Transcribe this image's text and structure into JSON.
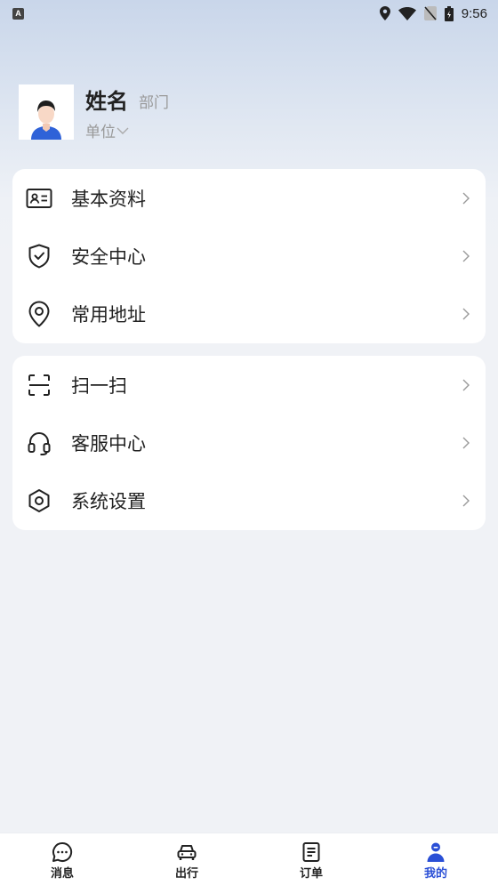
{
  "status_bar": {
    "app_badge": "A",
    "time": "9:56"
  },
  "profile": {
    "name": "姓名",
    "department": "部门",
    "unit": "单位"
  },
  "menu_group_1": [
    {
      "label": "基本资料",
      "icon": "id-card-icon"
    },
    {
      "label": "安全中心",
      "icon": "shield-check-icon"
    },
    {
      "label": "常用地址",
      "icon": "location-pin-icon"
    }
  ],
  "menu_group_2": [
    {
      "label": "扫一扫",
      "icon": "scan-icon"
    },
    {
      "label": "客服中心",
      "icon": "headset-icon"
    },
    {
      "label": "系统设置",
      "icon": "hexagon-settings-icon"
    }
  ],
  "tabbar": [
    {
      "label": "消息",
      "icon": "message-bubble-icon",
      "active": false
    },
    {
      "label": "出行",
      "icon": "car-icon",
      "active": false
    },
    {
      "label": "订单",
      "icon": "document-list-icon",
      "active": false
    },
    {
      "label": "我的",
      "icon": "person-icon",
      "active": true
    }
  ],
  "colors": {
    "accent": "#2a4fd6",
    "text": "#222222",
    "secondary_text": "#999999",
    "background": "#f0f2f6"
  }
}
